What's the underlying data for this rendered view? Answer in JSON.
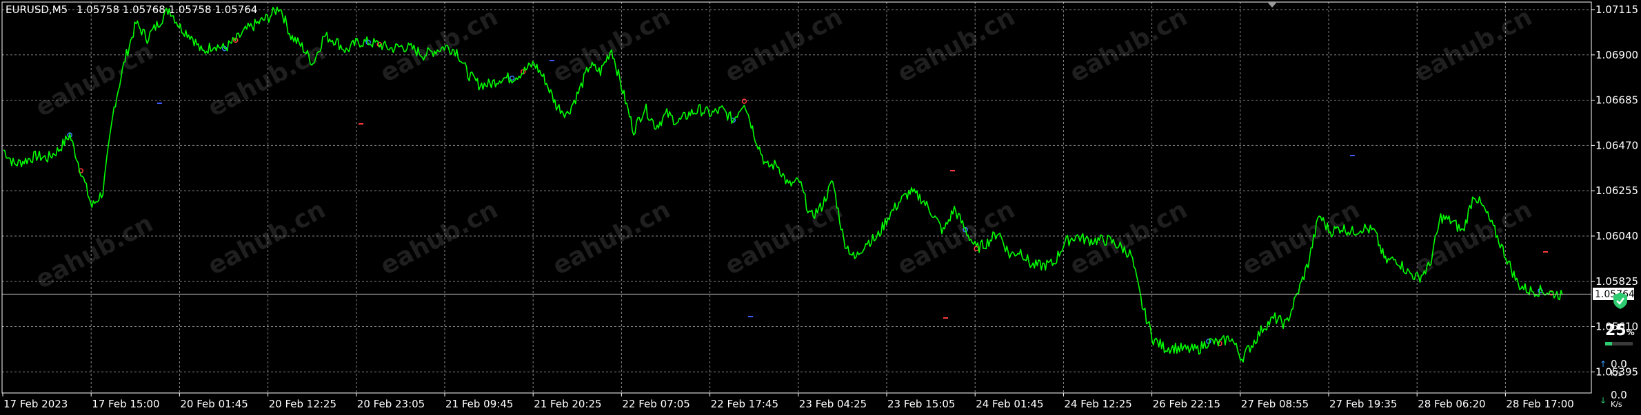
{
  "header": {
    "symbol_tf": "EURUSD,M5",
    "ohlc": "1.05758 1.05768 1.05758 1.05764"
  },
  "watermark": {
    "text": "eahub.cn"
  },
  "colors": {
    "background": "#000000",
    "price_line": "#00ff00",
    "grid": "#8a8a8a",
    "axis_text": "#ffffff",
    "current_price_bg": "#ffffff",
    "buy_marker": "#3b82ff",
    "sell_marker": "#ff3b3b",
    "widget_green": "#2ecc71"
  },
  "widget": {
    "icon": "shield-check-icon",
    "percent": "25",
    "percent_sign": "%",
    "progress": 0.25,
    "upload_value": "0.0",
    "upload_unit": "K/s",
    "download_value": "0.0",
    "download_unit": "K/s"
  },
  "chart_data": {
    "type": "line",
    "title": "EURUSD,M5",
    "ylim": [
      1.0537,
      1.07115
    ],
    "y_ticks": [
      "1.07115",
      "1.06900",
      "1.06685",
      "1.06470",
      "1.06255",
      "1.06040",
      "1.05825",
      "1.05610",
      "1.05395"
    ],
    "y_tick_values": [
      1.07115,
      1.069,
      1.06685,
      1.0647,
      1.06255,
      1.0604,
      1.05825,
      1.0561,
      1.05395
    ],
    "x_ticks": [
      "17 Feb 2023",
      "17 Feb 15:00",
      "20 Feb 01:45",
      "20 Feb 12:25",
      "20 Feb 23:05",
      "21 Feb 09:45",
      "21 Feb 20:25",
      "22 Feb 07:05",
      "22 Feb 17:45",
      "23 Feb 04:25",
      "23 Feb 15:05",
      "24 Feb 01:45",
      "24 Feb 12:25",
      "26 Feb 22:15",
      "27 Feb 08:55",
      "27 Feb 19:35",
      "28 Feb 06:20",
      "28 Feb 17:00"
    ],
    "current_price": 1.05764,
    "current_price_label": "1.05764",
    "grid": true,
    "series": [
      {
        "values": [
          1.0645,
          1.0638,
          1.064,
          1.0642,
          1.0641,
          1.0645,
          1.0652,
          1.0635,
          1.0618,
          1.0625,
          1.0665,
          1.0688,
          1.0705,
          1.0698,
          1.0705,
          1.0712,
          1.0703,
          1.0699,
          1.0691,
          1.0695,
          1.0693,
          1.0697,
          1.0702,
          1.0705,
          1.0708,
          1.0713,
          1.0699,
          1.0694,
          1.0686,
          1.0699,
          1.0697,
          1.0692,
          1.0696,
          1.0696,
          1.0695,
          1.0693,
          1.0694,
          1.0693,
          1.069,
          1.0692,
          1.0694,
          1.0692,
          1.0681,
          1.0676,
          1.0676,
          1.0679,
          1.0679,
          1.0682,
          1.0686,
          1.0678,
          1.0666,
          1.0662,
          1.0672,
          1.0685,
          1.0682,
          1.0693,
          1.0673,
          1.0654,
          1.0665,
          1.0656,
          1.0662,
          1.0658,
          1.0662,
          1.0664,
          1.0662,
          1.0664,
          1.0659,
          1.0668,
          1.0651,
          1.0637,
          1.0638,
          1.0628,
          1.063,
          1.0613,
          1.0618,
          1.063,
          1.0602,
          1.0593,
          1.0601,
          1.0603,
          1.0613,
          1.062,
          1.0625,
          1.0622,
          1.0615,
          1.0606,
          1.0617,
          1.0607,
          1.0598,
          1.0601,
          1.0606,
          1.0595,
          1.0597,
          1.059,
          1.059,
          1.0591,
          1.0601,
          1.0604,
          1.0602,
          1.0602,
          1.0602,
          1.0599,
          1.0595,
          1.0571,
          1.0555,
          1.0551,
          1.0551,
          1.055,
          1.055,
          1.0554,
          1.0553,
          1.0556,
          1.0546,
          1.0553,
          1.0561,
          1.0565,
          1.0562,
          1.0576,
          1.0591,
          1.0614,
          1.0606,
          1.0608,
          1.0606,
          1.0608,
          1.0606,
          1.0592,
          1.0593,
          1.0587,
          1.0584,
          1.059,
          1.0613,
          1.0611,
          1.0606,
          1.0624,
          1.0616,
          1.0605,
          1.0593,
          1.0581,
          1.0578,
          1.0578,
          1.0577,
          1.0576
        ]
      }
    ]
  }
}
